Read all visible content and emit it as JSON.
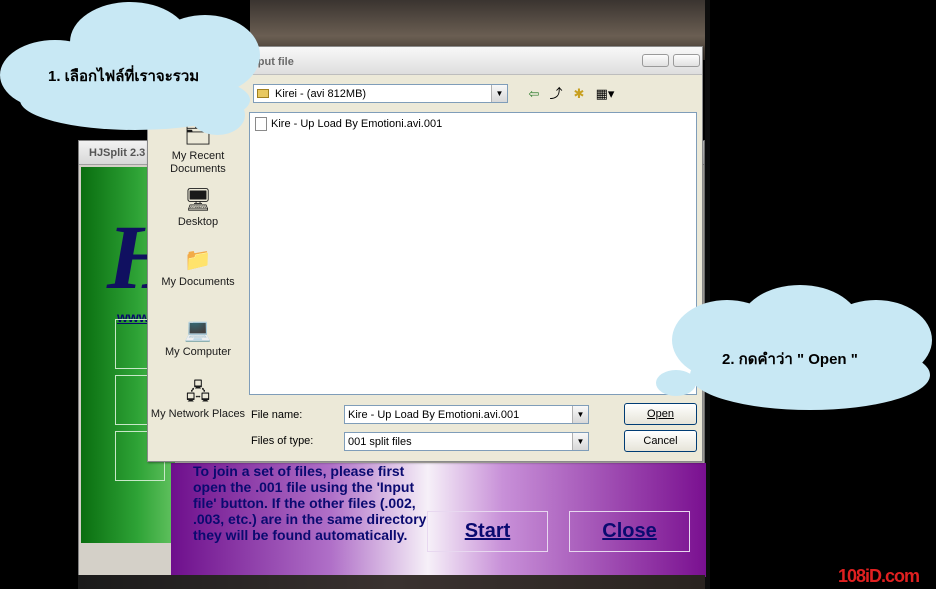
{
  "hjsplit": {
    "title": "HJSplit 2.3",
    "logo_letter": "H",
    "website": "www.",
    "info_text": "To join a set of files, please first open the .001 file using the 'Input file' button. If the other files (.002, .003, etc.) are in the same directory they will be found automatically.",
    "start_label": "Start",
    "close_label": "Close"
  },
  "dialog": {
    "title": "Input file",
    "look_in_value": "Kirei - (avi 812MB)",
    "places": [
      {
        "label": "My Recent Documents"
      },
      {
        "label": "Desktop"
      },
      {
        "label": "My Documents"
      },
      {
        "label": "My Computer"
      },
      {
        "label": "My Network Places"
      }
    ],
    "files": [
      "Kire - Up Load By Emotioni.avi.001"
    ],
    "file_name_label": "File name:",
    "file_name_value": "Kire - Up Load By Emotioni.avi.001",
    "file_type_label": "Files of type:",
    "file_type_value": "001 split files",
    "open_label": "Open",
    "cancel_label": "Cancel"
  },
  "bubbles": {
    "step1": "1.  เลือกไฟล์ที่เราจะรวม",
    "step2": "2.  กดคำว่า \" Open \""
  },
  "watermark": "108iD.com",
  "colors": {
    "bubble": "#c8e8f4",
    "hj_green": "#2ea336",
    "hj_purple": "#7a1090",
    "hj_text": "#0a0a70"
  }
}
